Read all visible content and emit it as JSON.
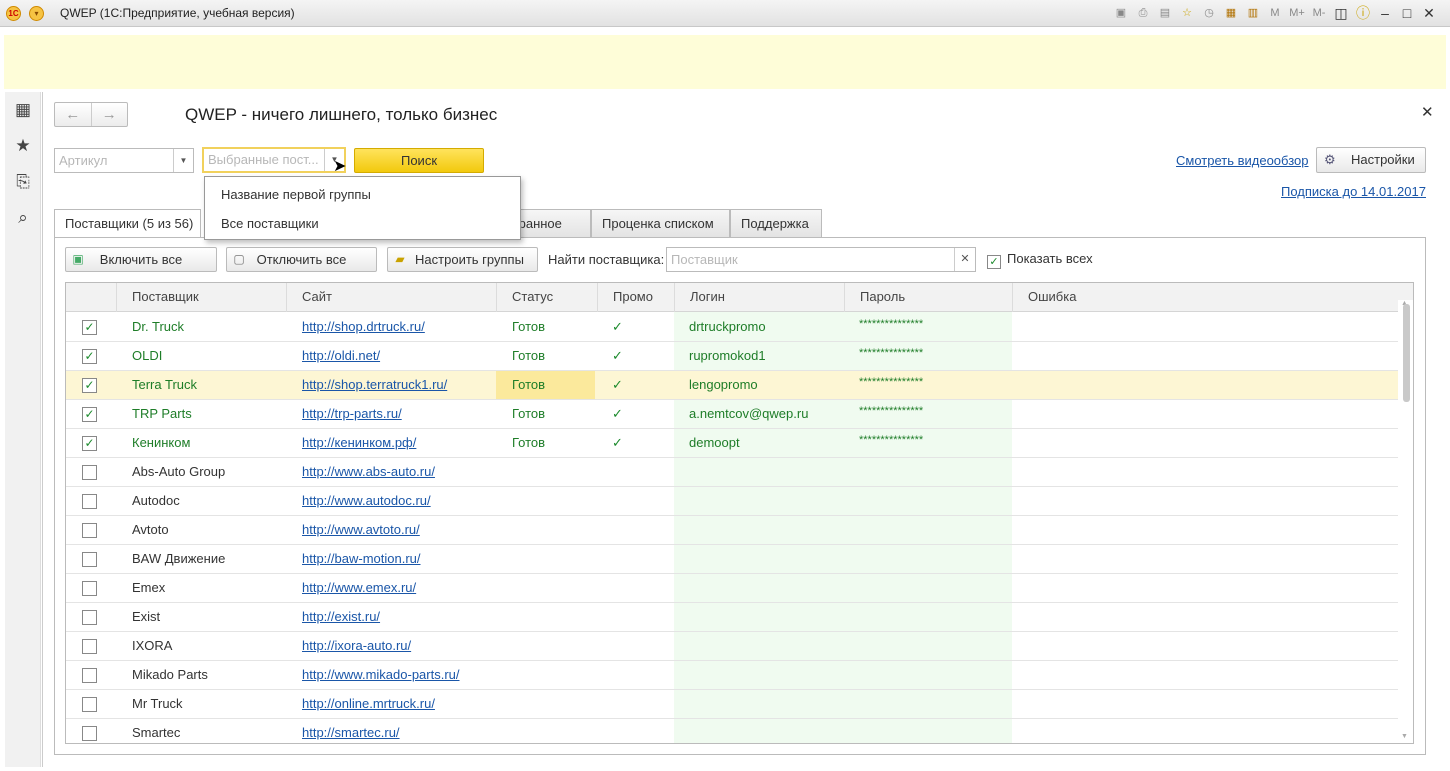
{
  "window": {
    "title": "QWEP  (1С:Предприятие, учебная версия)",
    "logo_text": "1С"
  },
  "toolbar_icons": [
    "save-icon",
    "print-icon",
    "preview-icon",
    "favorite-add-icon",
    "history-icon",
    "calculator-icon",
    "calendar-icon"
  ],
  "toolbar_text": {
    "m": "M",
    "m_plus": "M+",
    "m_minus": "M-"
  },
  "form": {
    "title": "QWEP - ничего лишнего, только бизнес",
    "article_placeholder": "Артикул",
    "supplier_placeholder": "Выбранные пост...",
    "search_label": "Поиск",
    "video_link": "Смотреть видеообзор",
    "settings_label": "Настройки",
    "subscription_link": "Подписка до 14.01.2017"
  },
  "dropdown": {
    "items": [
      "Название первой группы",
      "Все поставщики"
    ]
  },
  "tabs": [
    "Поставщики (5 из 56)",
    "Избранное",
    "Проценка  списком",
    "Поддержка"
  ],
  "actions": {
    "enable_all": "Включить все",
    "disable_all": "Отключить все",
    "setup_groups": "Настроить группы",
    "find_label": "Найти поставщика:",
    "find_placeholder": "Поставщик",
    "show_all": "Показать всех"
  },
  "grid": {
    "columns": [
      "Поставщик",
      "Сайт",
      "Статус",
      "Промо",
      "Логин",
      "Пароль",
      "Ошибка"
    ],
    "rows": [
      {
        "checked": true,
        "name": "Dr. Truck",
        "site": "http://shop.drtruck.ru/",
        "status": "Готов",
        "promo": "✓",
        "login": "drtruckpromo",
        "password": "***************",
        "selected": false
      },
      {
        "checked": true,
        "name": "OLDI",
        "site": "http://oldi.net/",
        "status": "Готов",
        "promo": "✓",
        "login": "rupromokod1",
        "password": "***************",
        "selected": false
      },
      {
        "checked": true,
        "name": "Terra Truck",
        "site": "http://shop.terratruck1.ru/",
        "status": "Готов",
        "promo": "✓",
        "login": "lengopromo",
        "password": "***************",
        "selected": true
      },
      {
        "checked": true,
        "name": "TRP Parts",
        "site": "http://trp-parts.ru/",
        "status": "Готов",
        "promo": "✓",
        "login": "a.nemtcov@qwep.ru",
        "password": "***************",
        "selected": false
      },
      {
        "checked": true,
        "name": "Кенинком",
        "site": "http://кенинком.рф/",
        "status": "Готов",
        "promo": "✓",
        "login": "demoopt",
        "password": "***************",
        "selected": false
      },
      {
        "checked": false,
        "name": "Abs-Auto Group",
        "site": "http://www.abs-auto.ru/",
        "status": "",
        "promo": "",
        "login": "",
        "password": "",
        "selected": false
      },
      {
        "checked": false,
        "name": "Autodoc",
        "site": "http://www.autodoc.ru/",
        "status": "",
        "promo": "",
        "login": "",
        "password": "",
        "selected": false
      },
      {
        "checked": false,
        "name": "Avtoto",
        "site": "http://www.avtoto.ru/",
        "status": "",
        "promo": "",
        "login": "",
        "password": "",
        "selected": false
      },
      {
        "checked": false,
        "name": "BAW Движение",
        "site": "http://baw-motion.ru/",
        "status": "",
        "promo": "",
        "login": "",
        "password": "",
        "selected": false
      },
      {
        "checked": false,
        "name": "Emex",
        "site": "http://www.emex.ru/",
        "status": "",
        "promo": "",
        "login": "",
        "password": "",
        "selected": false
      },
      {
        "checked": false,
        "name": "Exist",
        "site": "http://exist.ru/",
        "status": "",
        "promo": "",
        "login": "",
        "password": "",
        "selected": false
      },
      {
        "checked": false,
        "name": "IXORA",
        "site": "http://ixora-auto.ru/",
        "status": "",
        "promo": "",
        "login": "",
        "password": "",
        "selected": false
      },
      {
        "checked": false,
        "name": "Mikado Parts",
        "site": "http://www.mikado-parts.ru/",
        "status": "",
        "promo": "",
        "login": "",
        "password": "",
        "selected": false
      },
      {
        "checked": false,
        "name": "Mr Truck",
        "site": "http://online.mrtruck.ru/",
        "status": "",
        "promo": "",
        "login": "",
        "password": "",
        "selected": false
      },
      {
        "checked": false,
        "name": "Smartec",
        "site": "http://smartec.ru/",
        "status": "",
        "promo": "",
        "login": "",
        "password": "",
        "selected": false
      }
    ]
  }
}
